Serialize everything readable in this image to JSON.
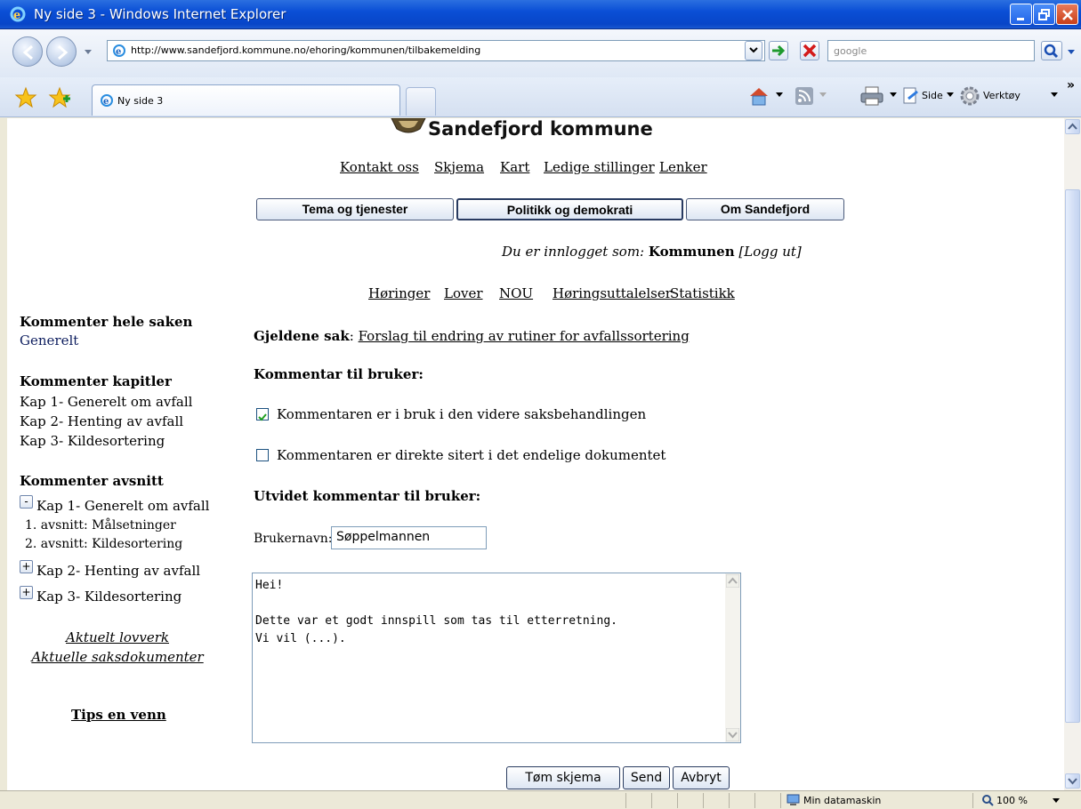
{
  "window": {
    "title": "Ny side 3 - Windows Internet Explorer"
  },
  "address": {
    "url": "http://www.sandefjord.kommune.no/ehoring/kommunen/tilbakemelding"
  },
  "search": {
    "placeholder": "google"
  },
  "tab": {
    "label": "Ny side 3"
  },
  "commandbar": {
    "side": "Side",
    "verktoy": "Verktøy"
  },
  "site": {
    "heading": "Sandefjord kommune",
    "top_links": [
      "Kontakt oss",
      "Skjema",
      "Kart",
      "Ledige stillinger",
      "Lenker"
    ],
    "nav_buttons": [
      "Tema og tjenester",
      "Politikk og demokrati",
      "Om Sandefjord"
    ],
    "login": {
      "prefix": "Du er innlogget som:",
      "user": "Kommunen",
      "logout": "[Logg ut]"
    },
    "sub_links": [
      "Høringer",
      "Lover",
      "NOU",
      "Høringsuttalelser",
      "Statistikk"
    ]
  },
  "sidebar": {
    "comment_all": {
      "title": "Kommenter hele saken",
      "item": "Generelt"
    },
    "chapters": {
      "title": "Kommenter kapitler",
      "items": [
        "Kap 1- Generelt om avfall",
        "Kap 2- Henting av avfall",
        "Kap 3- Kildesortering"
      ]
    },
    "sections": {
      "title": "Kommenter avsnitt",
      "tree": [
        {
          "toggle": "-",
          "label": "Kap 1- Generelt om avfall",
          "children": [
            "1. avsnitt: Målsetninger",
            "2. avsnitt: Kildesortering"
          ]
        },
        {
          "toggle": "+",
          "label": "Kap 2- Henting av avfall"
        },
        {
          "toggle": "+",
          "label": "Kap 3- Kildesortering"
        }
      ]
    },
    "links": [
      "Aktuelt lovverk",
      "Aktuelle saksdokumenter"
    ],
    "tips": "Tips en venn"
  },
  "main": {
    "case_label": "Gjeldene sak",
    "case_colon": ":",
    "case_title": "Forslag til endring av rutiner for avfallssortering",
    "comment_heading": "Kommentar til bruker:",
    "check1": {
      "label": "Kommentaren er i bruk i den videre saksbehandlingen",
      "checked": true
    },
    "check2": {
      "label": "Kommentaren er direkte sitert i det endelige dokumentet",
      "checked": false
    },
    "extended_heading": "Utvidet kommentar til bruker:",
    "username_label": "Brukernavn:",
    "username_value": "Søppelmannen",
    "comment_text": "Hei!\n\nDette var et godt innspill som tas til etterretning.\nVi vil (...).",
    "buttons": {
      "clear": "Tøm skjema",
      "send": "Send",
      "cancel": "Avbryt"
    }
  },
  "status": {
    "zone": "Min datamaskin",
    "zoom": "100 %"
  },
  "colors": {
    "titlebar": "#0a4fd6",
    "link": "#000000",
    "blue_item": "#0d1d5e"
  }
}
